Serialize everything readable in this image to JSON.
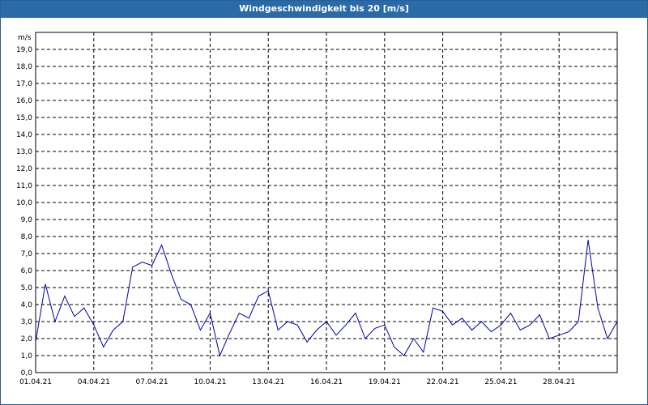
{
  "window": {
    "title": "Windgeschwindigkeit bis 20 [m/s]"
  },
  "chart_data": {
    "type": "line",
    "title": "Windgeschwindigkeit bis 20 [m/s]",
    "ylabel": "m/s",
    "xlabel": "",
    "ylim": [
      0,
      20
    ],
    "xlim": [
      "01.04.21",
      "01.05.21"
    ],
    "grid": true,
    "y_ticks": [
      "0,0",
      "1,0",
      "2,0",
      "3,0",
      "4,0",
      "5,0",
      "6,0",
      "7,0",
      "8,0",
      "9,0",
      "10,0",
      "11,0",
      "12,0",
      "13,0",
      "14,0",
      "15,0",
      "16,0",
      "17,0",
      "18,0",
      "19,0"
    ],
    "x_ticks": [
      "01.04.21",
      "04.04.21",
      "07.04.21",
      "10.04.21",
      "13.04.21",
      "16.04.21",
      "19.04.21",
      "22.04.21",
      "25.04.21",
      "28.04.21"
    ],
    "colors": {
      "line": "#0000a0",
      "grid": "#000000",
      "title_bar": "#2a6aa6"
    },
    "series": [
      {
        "x": [
          "01.04.21 00h",
          "01.04.21 12h",
          "02.04.21 00h",
          "02.04.21 12h",
          "03.04.21 00h",
          "03.04.21 12h",
          "04.04.21 00h",
          "04.04.21 12h",
          "05.04.21 00h",
          "05.04.21 12h",
          "06.04.21 00h",
          "06.04.21 12h",
          "07.04.21 00h",
          "07.04.21 12h",
          "08.04.21 00h",
          "08.04.21 12h",
          "09.04.21 00h",
          "09.04.21 12h",
          "10.04.21 00h",
          "10.04.21 12h",
          "11.04.21 00h",
          "11.04.21 12h",
          "12.04.21 00h",
          "12.04.21 12h",
          "13.04.21 00h",
          "13.04.21 12h",
          "14.04.21 00h",
          "14.04.21 12h",
          "15.04.21 00h",
          "15.04.21 12h",
          "16.04.21 00h",
          "16.04.21 12h",
          "17.04.21 00h",
          "17.04.21 12h",
          "18.04.21 00h",
          "18.04.21 12h",
          "19.04.21 00h",
          "19.04.21 12h",
          "20.04.21 00h",
          "20.04.21 12h",
          "21.04.21 00h",
          "21.04.21 12h",
          "22.04.21 00h",
          "22.04.21 12h",
          "23.04.21 00h",
          "23.04.21 12h",
          "24.04.21 00h",
          "24.04.21 12h",
          "25.04.21 00h",
          "25.04.21 12h",
          "26.04.21 00h",
          "26.04.21 12h",
          "27.04.21 00h",
          "27.04.21 12h",
          "28.04.21 00h",
          "28.04.21 12h",
          "29.04.21 00h",
          "29.04.21 12h",
          "30.04.21 00h",
          "30.04.21 12h",
          "01.05.21 00h"
        ],
        "values": [
          1.8,
          5.2,
          3.0,
          4.5,
          3.3,
          3.8,
          2.8,
          1.5,
          2.5,
          3.0,
          6.2,
          6.5,
          6.3,
          7.5,
          5.8,
          4.3,
          4.0,
          2.5,
          3.5,
          1.0,
          2.3,
          3.5,
          3.2,
          4.5,
          4.8,
          2.5,
          3.0,
          2.8,
          1.8,
          2.5,
          3.0,
          2.2,
          2.8,
          3.5,
          2.0,
          2.6,
          2.8,
          1.5,
          1.0,
          2.0,
          1.2,
          3.8,
          3.6,
          2.8,
          3.2,
          2.5,
          3.0,
          2.4,
          2.8,
          3.5,
          2.5,
          2.8,
          3.4,
          2.0,
          2.2,
          2.4,
          3.0,
          7.8,
          3.8,
          2.0,
          3.0
        ]
      }
    ]
  }
}
